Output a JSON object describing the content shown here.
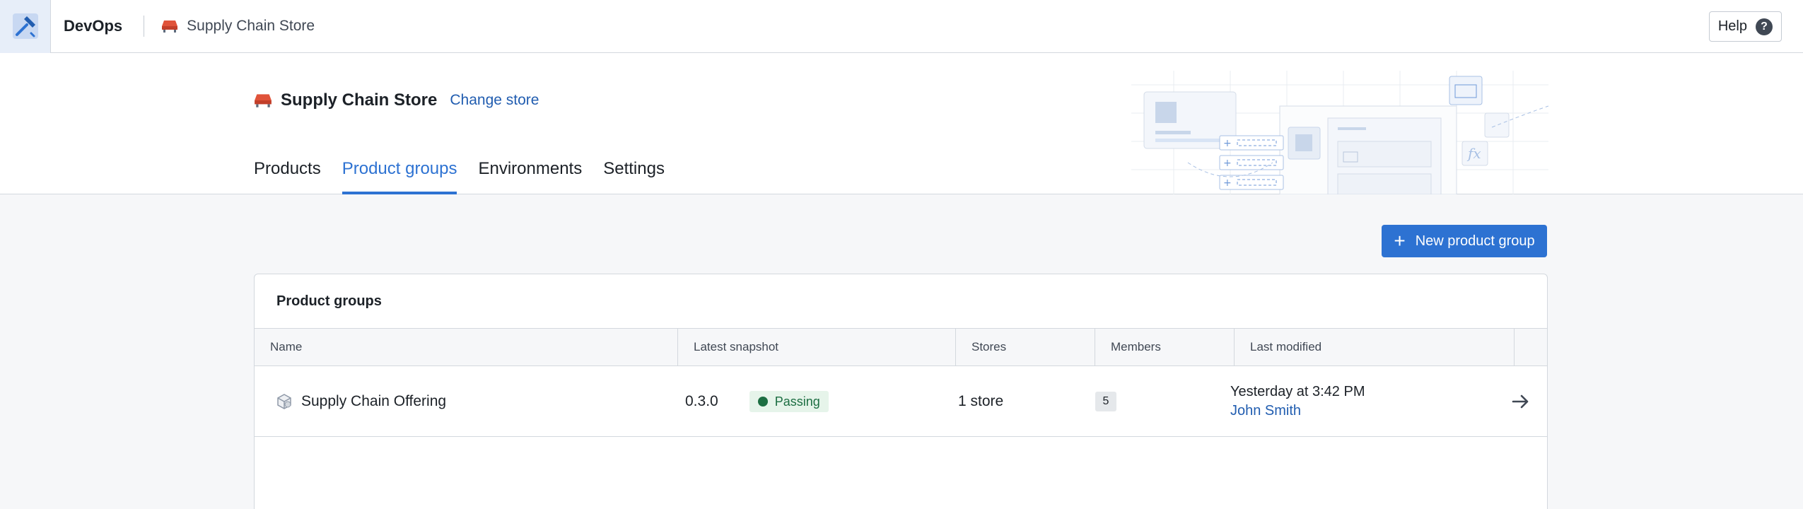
{
  "app": {
    "name": "DevOps"
  },
  "breadcrumb": {
    "store": "Supply Chain Store"
  },
  "help": {
    "label": "Help",
    "icon": "?"
  },
  "header": {
    "store_name": "Supply Chain Store",
    "change_store": "Change store",
    "tabs": [
      {
        "label": "Products",
        "active": false
      },
      {
        "label": "Product groups",
        "active": true
      },
      {
        "label": "Environments",
        "active": false
      },
      {
        "label": "Settings",
        "active": false
      }
    ]
  },
  "actions": {
    "new_group": "New product group"
  },
  "table": {
    "title": "Product groups",
    "columns": [
      "Name",
      "Latest snapshot",
      "Stores",
      "Members",
      "Last modified"
    ],
    "rows": [
      {
        "name": "Supply Chain Offering",
        "version": "0.3.0",
        "status": "Passing",
        "stores": "1 store",
        "members": "5",
        "modified_time": "Yesterday at 3:42 PM",
        "modified_by": "John Smith"
      }
    ]
  },
  "colors": {
    "accent": "#2d72d2",
    "link": "#215db0",
    "pass": "#1c6e42",
    "store_icon": "#e0533a"
  }
}
